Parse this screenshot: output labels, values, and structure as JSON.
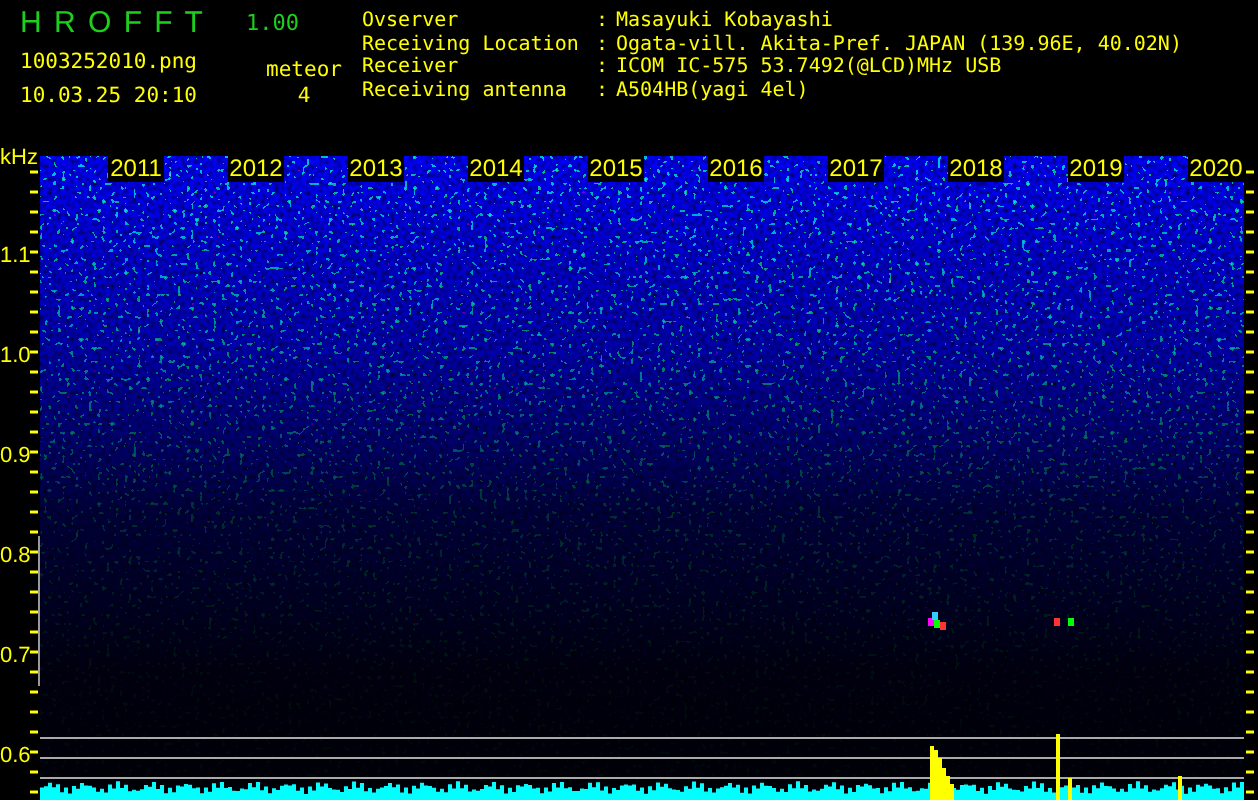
{
  "app": {
    "title": "H R O F F T",
    "version": "1.00"
  },
  "file": {
    "name": "1003252010.png",
    "timestamp": "10.03.25 20:10"
  },
  "meteor": {
    "label": "meteor",
    "count": "4"
  },
  "info": [
    {
      "label": "Ovserver",
      "separator": ":",
      "value": "Masayuki Kobayashi"
    },
    {
      "label": "Receiving Location",
      "separator": ":",
      "value": "Ogata-vill. Akita-Pref. JAPAN (139.96E, 40.02N)"
    },
    {
      "label": "Receiver",
      "separator": ":",
      "value": "ICOM IC-575 53.7492(@LCD)MHz USB"
    },
    {
      "label": "Receiving antenna",
      "separator": ":",
      "value": "A504HB(yagi 4el)"
    }
  ],
  "plot": {
    "y_unit": "kHz",
    "y_labels": [
      "1.1",
      "1.0",
      "0.9",
      "0.8",
      "0.7",
      "0.6"
    ],
    "x_labels": [
      "2011",
      "2012",
      "2013",
      "2014",
      "2015",
      "2016",
      "2017",
      "2018",
      "2019",
      "2020"
    ]
  }
}
